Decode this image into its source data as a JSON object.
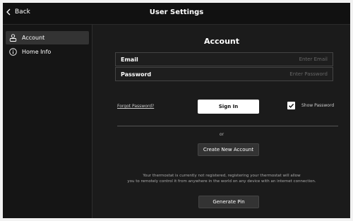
{
  "header": {
    "back_label": "Back",
    "title": "User Settings"
  },
  "sidebar": {
    "items": [
      {
        "label": "Account",
        "icon": "user-icon",
        "active": true
      },
      {
        "label": "Home Info",
        "icon": "info-icon",
        "active": false
      }
    ]
  },
  "account": {
    "title": "Account",
    "email": {
      "label": "Email",
      "placeholder": "Enter Email",
      "value": ""
    },
    "password": {
      "label": "Password",
      "placeholder": "Enter Password",
      "value": ""
    },
    "forgot_label": "Forgot Password?",
    "signin_label": "Sign In",
    "show_password_label": "Show Password",
    "show_password_checked": true,
    "or_label": "or",
    "create_label": "Create New Account",
    "info_line1": "Your thermostat is currently not registered, registering your thermostat will allow",
    "info_line2": "you to remotely control it from anywhere in the world on any device with an internet connection.",
    "pin_label": "Generate Pin"
  }
}
